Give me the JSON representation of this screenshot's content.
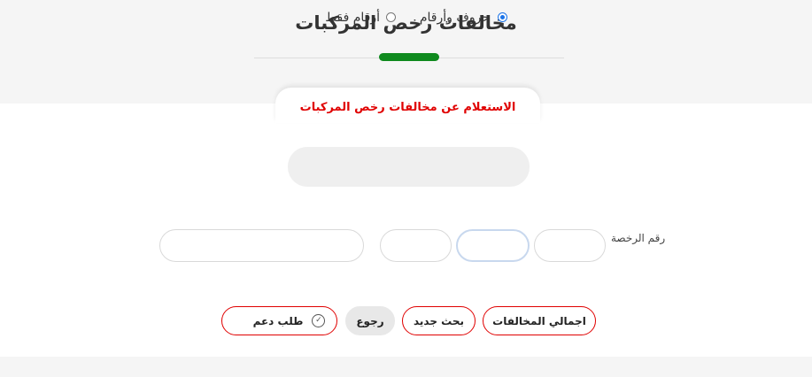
{
  "header": {
    "title": "مخالفات رخص المركبات"
  },
  "tab": {
    "label": "الاستعلام عن مخالفات رخص المركبات"
  },
  "plate_type": {
    "options": [
      {
        "label": "حروف وأرقام",
        "selected": true
      },
      {
        "label": "أرقام فقط",
        "selected": false
      }
    ]
  },
  "license": {
    "label": "رقم الرخصة",
    "fields": [
      "",
      "",
      "",
      ""
    ]
  },
  "buttons": {
    "total": "اجمالي المخالفات",
    "new_search": "بحث جديد",
    "back": "رجوع",
    "support": "طلب دعم"
  },
  "colors": {
    "accent_green": "#0f8a1e",
    "accent_red": "#e00000",
    "radio_blue": "#1a73e8"
  }
}
